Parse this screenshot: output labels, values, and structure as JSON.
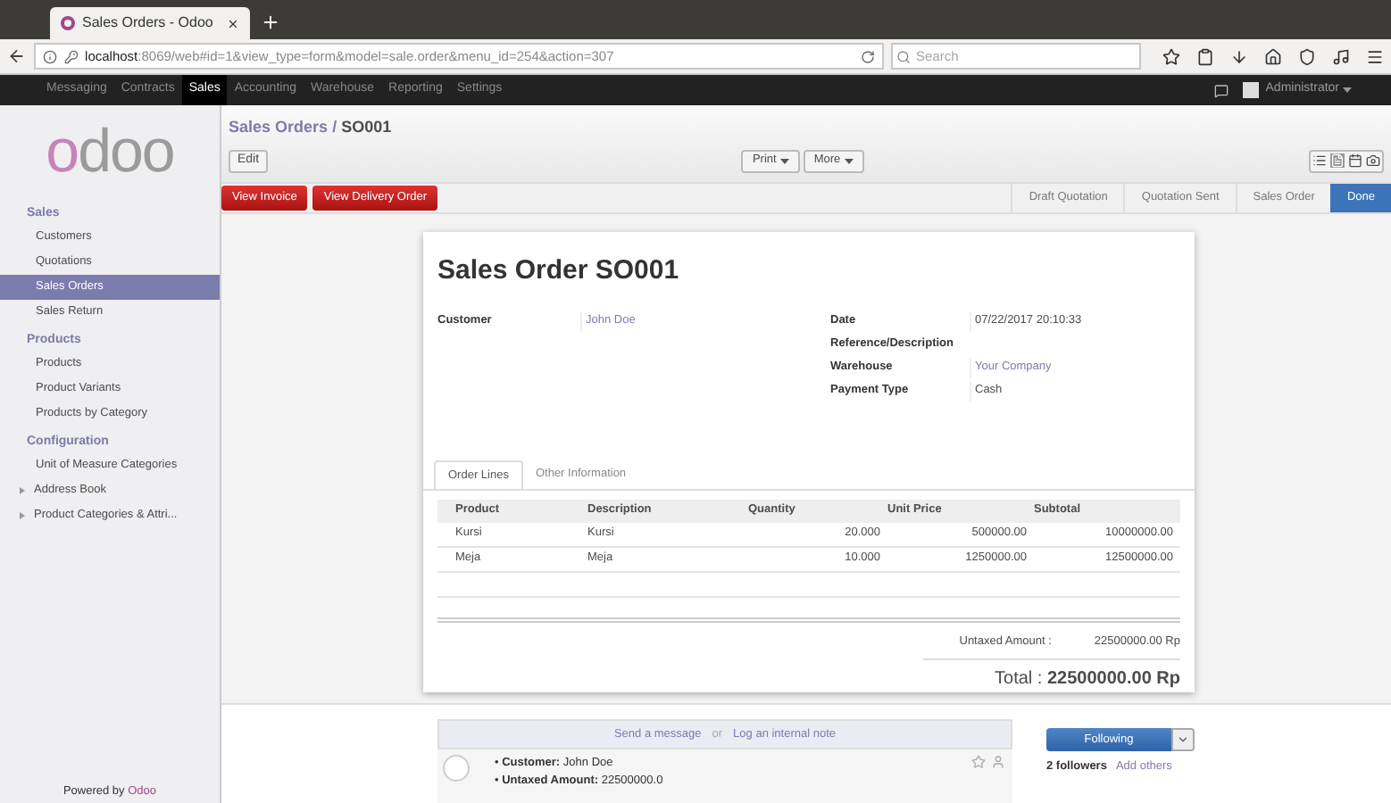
{
  "browser": {
    "tab_title": "Sales Orders - Odoo",
    "url_host": "localhost",
    "url_rest": ":8069/web#id=1&view_type=form&model=sale.order&menu_id=254&action=307",
    "search_placeholder": "Search"
  },
  "top_menu": {
    "items": [
      {
        "label": "Messaging",
        "selected": false
      },
      {
        "label": "Contracts",
        "selected": false
      },
      {
        "label": "Sales",
        "selected": true
      },
      {
        "label": "Accounting",
        "selected": false
      },
      {
        "label": "Warehouse",
        "selected": false
      },
      {
        "label": "Reporting",
        "selected": false
      },
      {
        "label": "Settings",
        "selected": false
      }
    ],
    "user": "Administrator"
  },
  "sidebar": {
    "logo": "odoo",
    "sections": [
      {
        "title": "Sales",
        "items": [
          {
            "label": "Customers",
            "selected": false,
            "expandable": false
          },
          {
            "label": "Quotations",
            "selected": false,
            "expandable": false
          },
          {
            "label": "Sales Orders",
            "selected": true,
            "expandable": false
          },
          {
            "label": "Sales Return",
            "selected": false,
            "expandable": false
          }
        ]
      },
      {
        "title": "Products",
        "items": [
          {
            "label": "Products",
            "selected": false,
            "expandable": false
          },
          {
            "label": "Product Variants",
            "selected": false,
            "expandable": false
          },
          {
            "label": "Products by Category",
            "selected": false,
            "expandable": false
          }
        ]
      },
      {
        "title": "Configuration",
        "items": [
          {
            "label": "Unit of Measure Categories",
            "selected": false,
            "expandable": false
          },
          {
            "label": "Address Book",
            "selected": false,
            "expandable": true
          },
          {
            "label": "Product Categories & Attri...",
            "selected": false,
            "expandable": true
          }
        ]
      }
    ],
    "powered_by": "Powered by",
    "powered_by_link": "Odoo"
  },
  "breadcrumb": {
    "parent": "Sales Orders",
    "separator": "/",
    "current": "SO001"
  },
  "toolbar": {
    "edit": "Edit",
    "menus": [
      "Print",
      "More"
    ]
  },
  "actions": [
    "View Invoice",
    "View Delivery Order"
  ],
  "stages": [
    {
      "label": "Draft Quotation",
      "selected": false
    },
    {
      "label": "Quotation Sent",
      "selected": false
    },
    {
      "label": "Sales Order",
      "selected": false
    },
    {
      "label": "Done",
      "selected": true
    }
  ],
  "sheet": {
    "title": "Sales Order SO001",
    "left_fields": [
      {
        "label": "Customer",
        "value": "John Doe",
        "kind": "link"
      }
    ],
    "right_fields": [
      {
        "label": "Date",
        "value": "07/22/2017 20:10:33",
        "kind": "text"
      },
      {
        "label": "Reference/Description",
        "kind": "empty"
      },
      {
        "label": "Warehouse",
        "value": "Your Company",
        "kind": "link"
      },
      {
        "label": "Payment Type",
        "value": "Cash",
        "kind": "text"
      }
    ],
    "tabs": [
      {
        "label": "Order Lines",
        "selected": true
      },
      {
        "label": "Other Information",
        "selected": false
      }
    ],
    "columns": [
      "Product",
      "Description",
      "Quantity",
      "Unit Price",
      "Subtotal"
    ],
    "rows": [
      [
        "Kursi",
        "Kursi",
        "20.000",
        "500000.00",
        "10000000.00"
      ],
      [
        "Meja",
        "Meja",
        "10.000",
        "1250000.00",
        "12500000.00"
      ]
    ],
    "untaxed_label": "Untaxed Amount :",
    "untaxed_value": "22500000.00 Rp",
    "total_label": "Total :",
    "total_value": "22500000.00 Rp"
  },
  "chatter": {
    "send_message": "Send a message",
    "or": "or",
    "log_note": "Log an internal note",
    "message_lines": [
      "• **Customer:** John Doe",
      "• **Untaxed Amount:** 22500000.0"
    ],
    "following": "Following",
    "followers": "2 followers",
    "add_others": "Add others"
  }
}
